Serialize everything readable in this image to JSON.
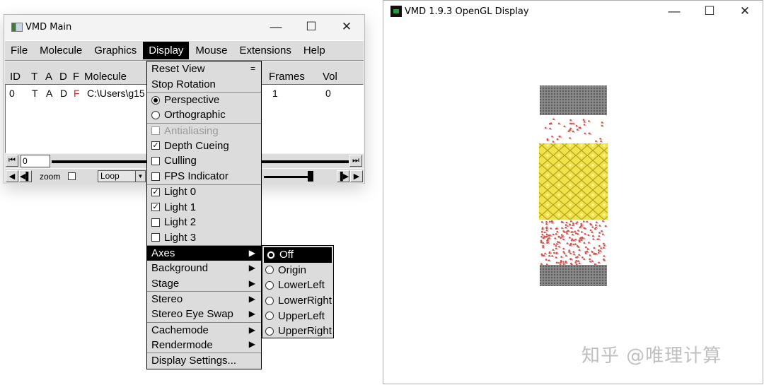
{
  "main_window": {
    "title": "VMD Main",
    "controls": {
      "minimize": "—",
      "maximize": "☐",
      "close": "✕"
    },
    "menu": [
      "File",
      "Molecule",
      "Graphics",
      "Display",
      "Mouse",
      "Extensions",
      "Help"
    ],
    "active_menu": "Display",
    "columns": {
      "id": "ID",
      "t": "T",
      "a": "A",
      "d": "D",
      "f": "F",
      "molecule": "Molecule",
      "frames": "Frames",
      "vol": "Vol"
    },
    "rows": [
      {
        "id": "0",
        "t": "T",
        "a": "A",
        "d": "D",
        "f": "F",
        "molecule": "C:\\Users\\g15",
        "frames": "1",
        "vol": "0"
      }
    ],
    "frame_value": "0",
    "zoom_label": "zoom",
    "loop_mode": "Loop"
  },
  "display_menu": {
    "reset_view": "Reset View",
    "reset_view_shortcut": "=",
    "stop_rotation": "Stop Rotation",
    "perspective": "Perspective",
    "orthographic": "Orthographic",
    "antialiasing": "Antialiasing",
    "depth_cueing": "Depth Cueing",
    "culling": "Culling",
    "fps_indicator": "FPS Indicator",
    "light0": "Light 0",
    "light1": "Light 1",
    "light2": "Light 2",
    "light3": "Light 3",
    "axes": "Axes",
    "background": "Background",
    "stage": "Stage",
    "stereo": "Stereo",
    "stereo_eye_swap": "Stereo Eye Swap",
    "cachemode": "Cachemode",
    "rendermode": "Rendermode",
    "display_settings": "Display Settings...",
    "arrow": "▶",
    "check": "✓",
    "state": {
      "projection": "Perspective",
      "antialiasing": false,
      "depth_cueing": true,
      "culling": false,
      "fps_indicator": false,
      "light0": true,
      "light1": true,
      "light2": false,
      "light3": false
    }
  },
  "axes_submenu": {
    "options": [
      "Off",
      "Origin",
      "LowerLeft",
      "LowerRight",
      "UpperLeft",
      "UpperRight"
    ],
    "selected": "Off"
  },
  "gl_window": {
    "title": "VMD 1.9.3 OpenGL Display",
    "controls": {
      "minimize": "—",
      "maximize": "☐",
      "close": "✕"
    },
    "watermark": "知乎 @唯理计算",
    "colors": {
      "graphene": "#7a7a7a",
      "polymer": "#f2e24a",
      "water": "#c8564e",
      "background": "#ffffff"
    }
  },
  "colors": {
    "menu_bg": "#dcdcdc",
    "highlight": "#000000",
    "disabled_text": "#9a9a9a",
    "flag_red": "#e02020"
  }
}
